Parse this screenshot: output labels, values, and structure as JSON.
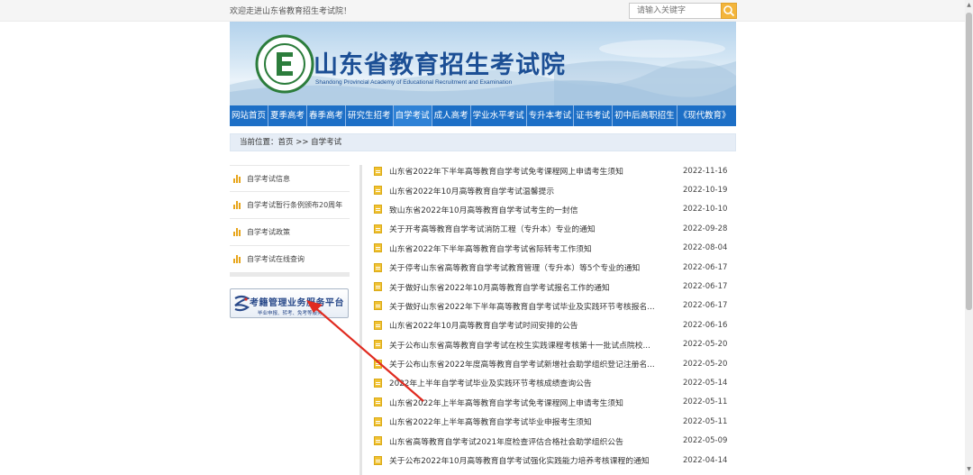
{
  "topbar": {
    "welcome": "欢迎走进山东省教育招生考试院！",
    "search_placeholder": "请输入关键字"
  },
  "banner": {
    "title_cn": "山东省教育招生考试院",
    "title_en": "Shandong Provincial Academy of Educational Recruitment and Examination"
  },
  "nav": {
    "items": [
      {
        "label": "网站首页"
      },
      {
        "label": "夏季高考"
      },
      {
        "label": "春季高考"
      },
      {
        "label": "研究生招考"
      },
      {
        "label": "自学考试"
      },
      {
        "label": "成人高考"
      },
      {
        "label": "学业水平考试"
      },
      {
        "label": "专升本考试"
      },
      {
        "label": "证书考试"
      },
      {
        "label": "初中后高职招生"
      },
      {
        "label": "《现代教育》"
      }
    ],
    "active_color": "#2f82d6",
    "bar_color": "#1d6fc6"
  },
  "breadcrumb": {
    "text": "当前位置：首页 >> 自学考试"
  },
  "sidebar": {
    "items": [
      {
        "label": "自学考试信息"
      },
      {
        "label": "自学考试暂行条例颁布20周年"
      },
      {
        "label": "自学考试政策"
      },
      {
        "label": "自学考试在线查询"
      }
    ],
    "platform_title": "考籍管理业务服务平台",
    "platform_sub": "毕业申报、转考、免考等服务"
  },
  "news": [
    {
      "title": "山东省2022年下半年高等教育自学考试免考课程网上申请考生须知",
      "date": "2022-11-16"
    },
    {
      "title": "山东省2022年10月高等教育自学考试温馨提示",
      "date": "2022-10-19"
    },
    {
      "title": "致山东省2022年10月高等教育自学考试考生的一封信",
      "date": "2022-10-10"
    },
    {
      "title": "关于开考高等教育自学考试消防工程（专升本）专业的通知",
      "date": "2022-09-28"
    },
    {
      "title": "山东省2022年下半年高等教育自学考试省际转考工作须知",
      "date": "2022-08-04"
    },
    {
      "title": "关于停考山东省高等教育自学考试教育管理（专升本）等5个专业的通知",
      "date": "2022-06-17"
    },
    {
      "title": "关于做好山东省2022年10月高等教育自学考试报名工作的通知",
      "date": "2022-06-17"
    },
    {
      "title": "关于做好山东省2022年下半年高等教育自学考试毕业及实践环节考核报名...",
      "date": "2022-06-17"
    },
    {
      "title": "山东省2022年10月高等教育自学考试时间安排的公告",
      "date": "2022-06-16"
    },
    {
      "title": "关于公布山东省高等教育自学考试在校生实践课程考核第十一批试点院校...",
      "date": "2022-05-20"
    },
    {
      "title": "关于公布山东省2022年度高等教育自学考试新增社会助学组织登记注册名...",
      "date": "2022-05-20"
    },
    {
      "title": "2022年上半年自学考试毕业及实践环节考核成绩查询公告",
      "date": "2022-05-14"
    },
    {
      "title": "山东省2022年上半年高等教育自学考试免考课程网上申请考生须知",
      "date": "2022-05-11"
    },
    {
      "title": "山东省2022年上半年高等教育自学考试毕业申报考生须知",
      "date": "2022-05-11"
    },
    {
      "title": "山东省高等教育自学考试2021年度检查评估合格社会助学组织公告",
      "date": "2022-05-09"
    },
    {
      "title": "关于公布2022年10月高等教育自学考试强化实践能力培养考核课程的通知",
      "date": "2022-04-14"
    }
  ],
  "colors": {
    "accent_orange": "#f3b53b",
    "icon_yellow": "#f1c232",
    "annotation_red": "#e02b20"
  }
}
